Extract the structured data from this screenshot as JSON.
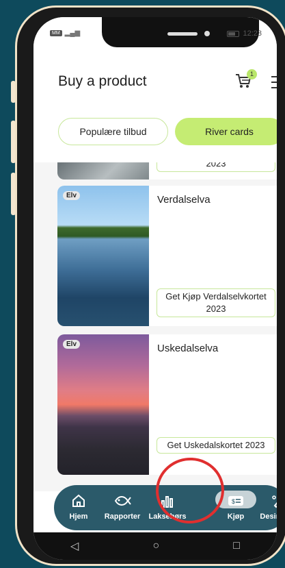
{
  "status_bar": {
    "sim_label": "MM",
    "time": "12:23"
  },
  "header": {
    "title": "Buy a product",
    "cart_count": "1"
  },
  "tabs": [
    {
      "label": "Populære tilbud",
      "active": false
    },
    {
      "label": "River cards",
      "active": true
    }
  ],
  "cards": [
    {
      "badge": "",
      "title": "",
      "button": "2023"
    },
    {
      "badge": "Elv",
      "title": "Verdalselva",
      "button": "Get Kjøp Verdalselvkortet 2023"
    },
    {
      "badge": "Elv",
      "title": "Uskedalselva",
      "button": "Get Uskedalskortet 2023"
    }
  ],
  "bottom_nav": [
    {
      "label": "Hjem",
      "icon": "home-icon"
    },
    {
      "label": "Rapporter",
      "icon": "fish-icon"
    },
    {
      "label": "Laksebørs",
      "icon": "bar-chart-icon"
    },
    {
      "label": "Kjøp",
      "icon": "ticket-icon",
      "active": true
    },
    {
      "label": "Desinfiser",
      "icon": "disinfect-icon"
    }
  ],
  "colors": {
    "accent": "#c5ec73",
    "nav_bg": "#2b5a6a",
    "highlight": "#e02f2f"
  }
}
